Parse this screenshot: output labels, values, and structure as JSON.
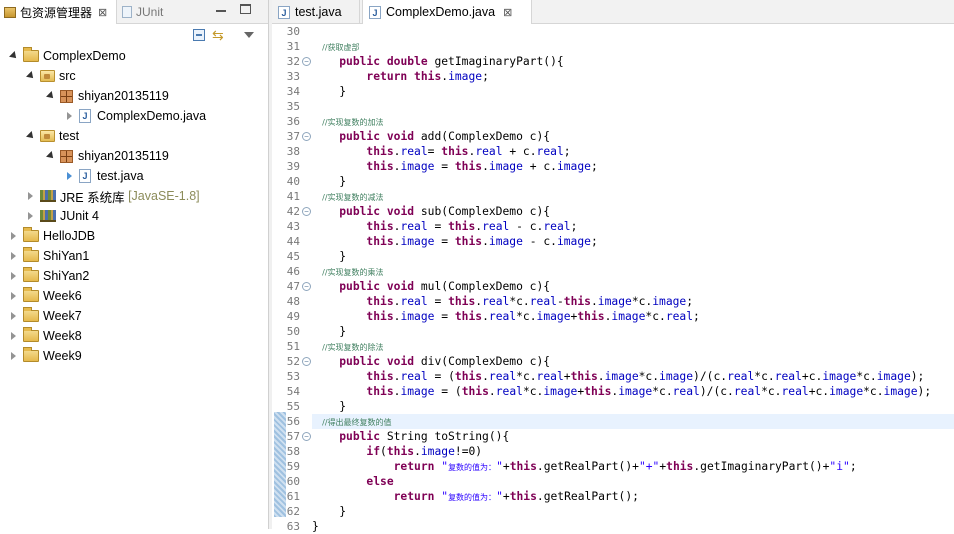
{
  "left_panel": {
    "tabs": [
      {
        "label": "包资源管理器",
        "close": "⊠"
      },
      {
        "label": "JUnit"
      }
    ],
    "tree": [
      {
        "label": "ComplexDemo",
        "type": "project",
        "expanded": true
      },
      {
        "label": "src",
        "type": "folder",
        "expanded": true
      },
      {
        "label": "shiyan20135119",
        "type": "package",
        "expanded": true
      },
      {
        "label": "ComplexDemo.java",
        "type": "java"
      },
      {
        "label": "test",
        "type": "folder",
        "expanded": true
      },
      {
        "label": "shiyan20135119",
        "type": "package",
        "expanded": true
      },
      {
        "label": "test.java",
        "type": "java"
      },
      {
        "label": "JRE 系统库",
        "suffix": "[JavaSE-1.8]",
        "type": "library"
      },
      {
        "label": "JUnit 4",
        "type": "library"
      },
      {
        "label": "HelloJDB",
        "type": "project"
      },
      {
        "label": "ShiYan1",
        "type": "project"
      },
      {
        "label": "ShiYan2",
        "type": "project"
      },
      {
        "label": "Week6",
        "type": "project"
      },
      {
        "label": "Week7",
        "type": "project"
      },
      {
        "label": "Week8",
        "type": "project"
      },
      {
        "label": "Week9",
        "type": "project"
      }
    ]
  },
  "editor": {
    "tabs": [
      {
        "label": "test.java"
      },
      {
        "label": "ComplexDemo.java",
        "close": "⊠"
      }
    ],
    "line_numbers": [
      "30",
      "31",
      "32",
      "33",
      "34",
      "35",
      "36",
      "37",
      "38",
      "39",
      "40",
      "41",
      "42",
      "43",
      "44",
      "45",
      "46",
      "47",
      "48",
      "49",
      "50",
      "51",
      "52",
      "53",
      "54",
      "55",
      "56",
      "57",
      "58",
      "59",
      "60",
      "61",
      "62",
      "63"
    ],
    "comments": {
      "c31": "    //获取虚部",
      "c36": "    //实现复数的加法",
      "c41": "    //实现复数的减法",
      "c46": "    //实现复数的乘法",
      "c51": "    //实现复数的除法",
      "c56": "    //得出最终复数的值",
      "s59": "复数的值为：",
      "s61": "复数的值为："
    }
  },
  "colors": {
    "keyword": "#7f0055",
    "field": "#0000c0",
    "comment": "#3f7f5f",
    "string": "#2a00ff"
  }
}
